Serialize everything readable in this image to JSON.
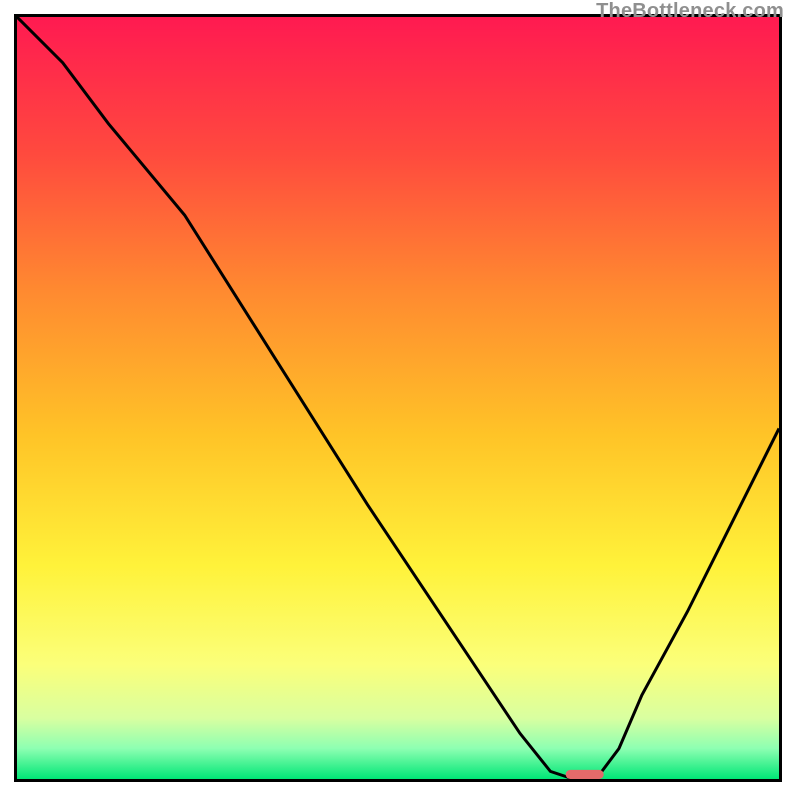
{
  "watermark": "TheBottleneck.com",
  "chart_data": {
    "type": "line",
    "title": "",
    "xlabel": "",
    "ylabel": "",
    "xlim": [
      0,
      100
    ],
    "ylim": [
      0,
      100
    ],
    "grid": false,
    "legend": false,
    "background": {
      "type": "vertical-gradient",
      "stops": [
        {
          "pct": 0,
          "color": "#ff1a51"
        },
        {
          "pct": 18,
          "color": "#ff4a3e"
        },
        {
          "pct": 36,
          "color": "#ff8a30"
        },
        {
          "pct": 55,
          "color": "#ffc427"
        },
        {
          "pct": 72,
          "color": "#fff23a"
        },
        {
          "pct": 85,
          "color": "#fbff7a"
        },
        {
          "pct": 92,
          "color": "#d9ffa0"
        },
        {
          "pct": 96,
          "color": "#8dffb2"
        },
        {
          "pct": 100,
          "color": "#00e676"
        }
      ]
    },
    "series": [
      {
        "name": "bottleneck-curve",
        "x": [
          0,
          6,
          12,
          22,
          34,
          46,
          58,
          66,
          70,
          73,
          76,
          79,
          82,
          88,
          94,
          100
        ],
        "y": [
          100,
          94,
          86,
          74,
          55,
          36,
          18,
          6,
          1,
          0,
          0,
          4,
          11,
          22,
          34,
          46
        ],
        "stroke": "#000000",
        "stroke_width": 3
      }
    ],
    "marker": {
      "name": "optimal-point",
      "x": 74.5,
      "y": 0,
      "width": 5,
      "height": 1.2,
      "rx": 0.6,
      "fill": "#e46a6a"
    }
  }
}
